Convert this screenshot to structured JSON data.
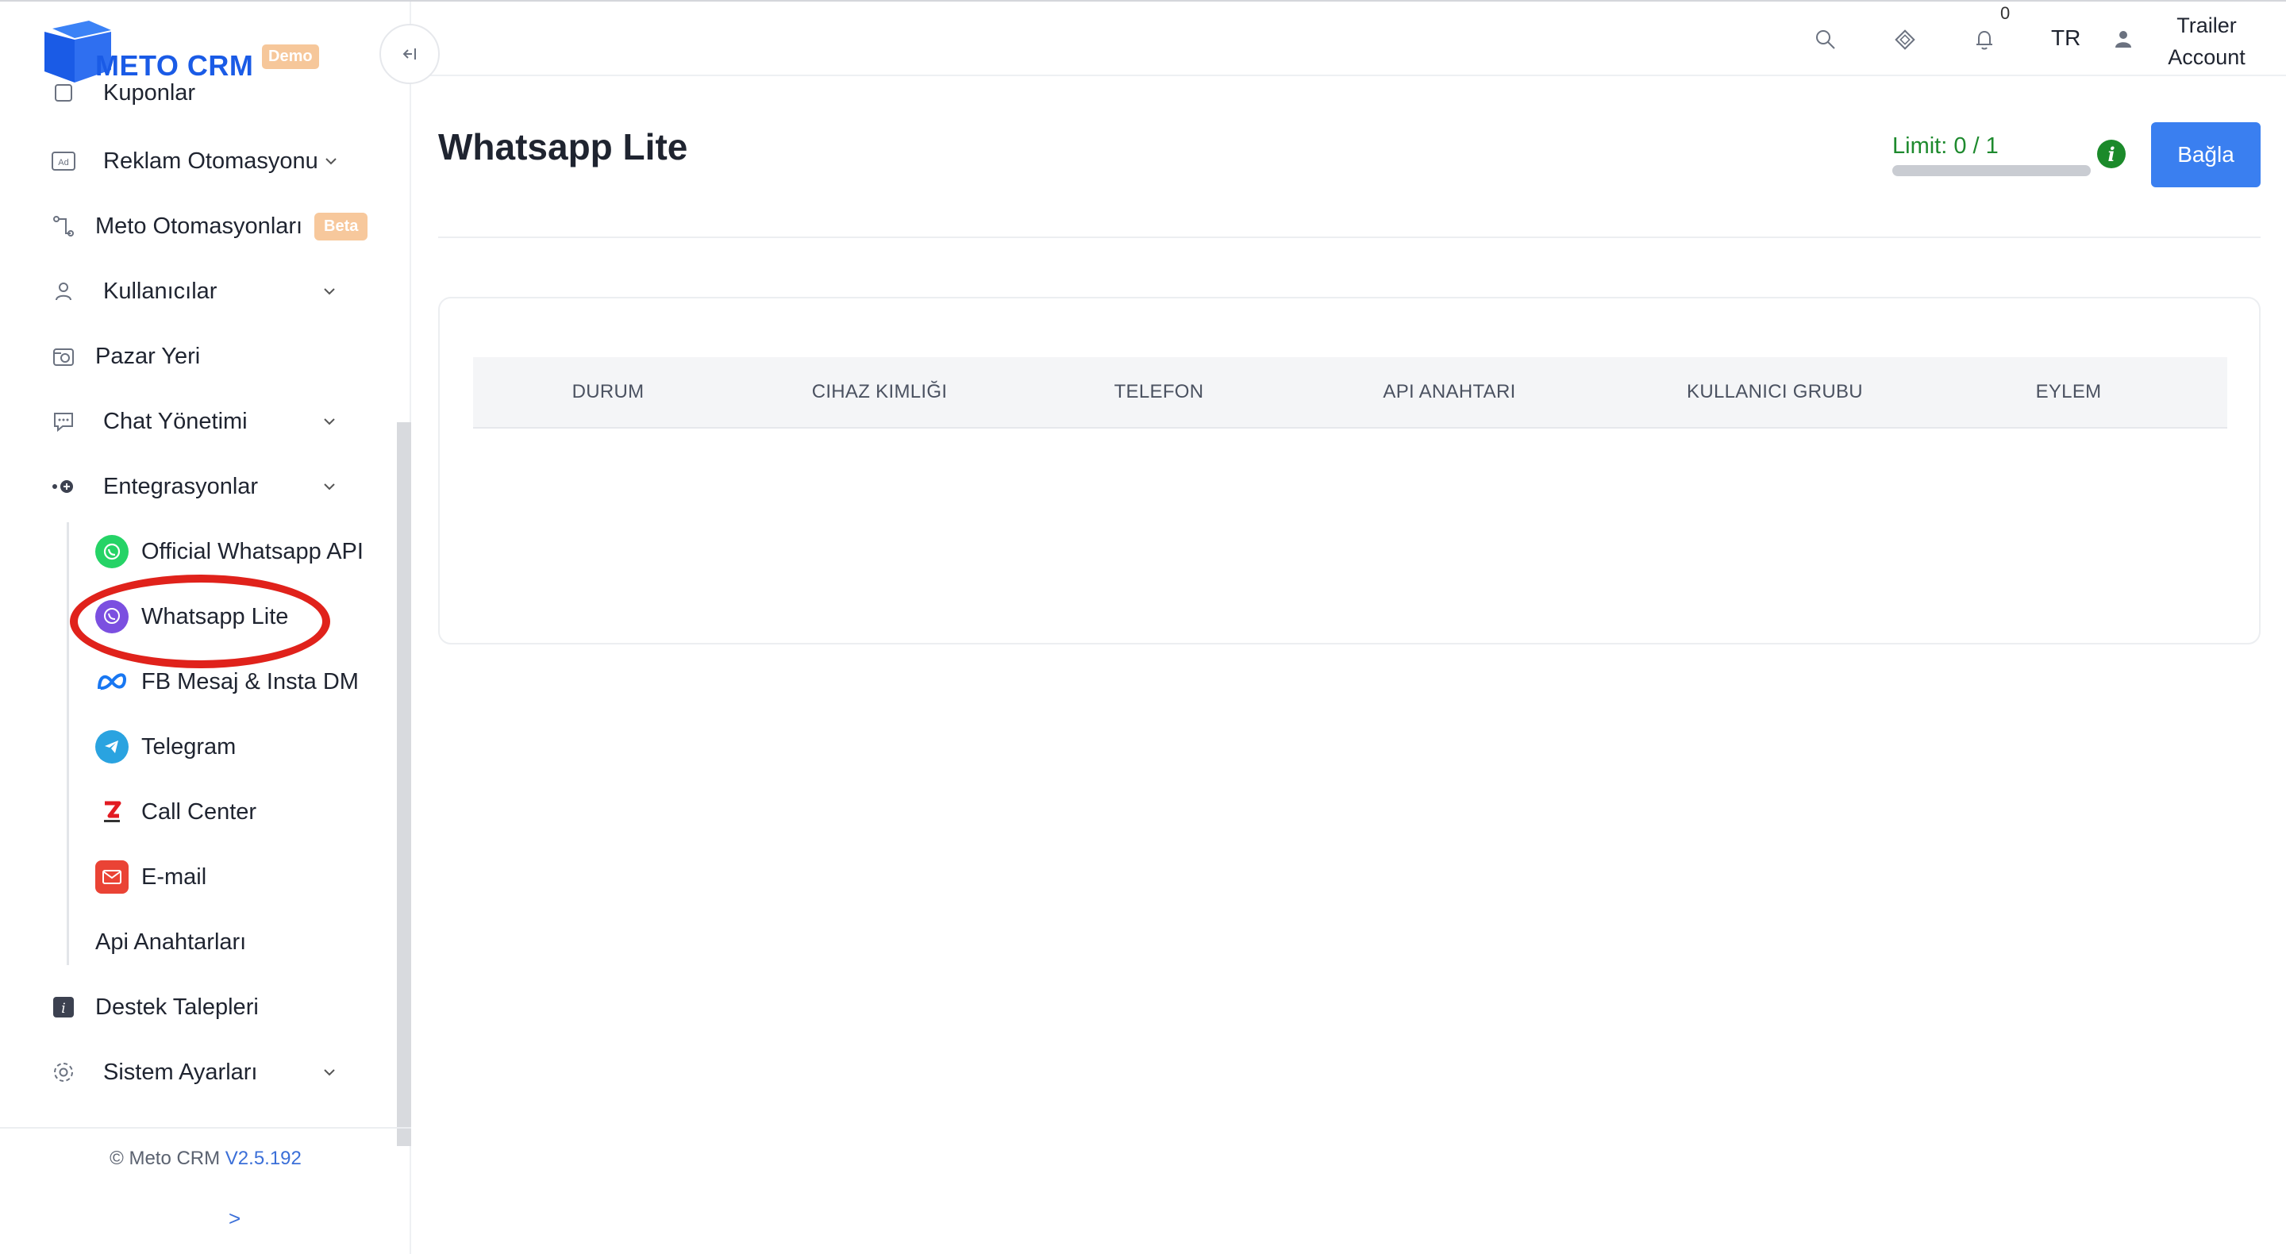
{
  "brand": {
    "name": "METO CRM",
    "badge": "Demo",
    "accent": "#1a5be6"
  },
  "sidebar": {
    "partial_item": "Kuponlar",
    "items": [
      {
        "label": "Reklam Otomasyonu",
        "icon": "ad-icon",
        "expandable": true
      },
      {
        "label": "Meto Otomasyonları",
        "icon": "flow-icon",
        "badge": "Beta"
      },
      {
        "label": "Kullanıcılar",
        "icon": "user-icon",
        "expandable": true
      },
      {
        "label": "Pazar Yeri",
        "icon": "marketplace-icon"
      },
      {
        "label": "Chat Yönetimi",
        "icon": "chat-icon",
        "expandable": true
      },
      {
        "label": "Entegrasyonlar",
        "icon": "integration-icon",
        "expandable": true
      }
    ],
    "sub_items": [
      {
        "label": "Official Whatsapp API",
        "icon": "whatsapp-icon"
      },
      {
        "label": "Whatsapp Lite",
        "icon": "viber-icon",
        "active": true
      },
      {
        "label": "FB Mesaj & Insta DM",
        "icon": "meta-icon"
      },
      {
        "label": "Telegram",
        "icon": "telegram-icon"
      },
      {
        "label": "Call Center",
        "icon": "call-center-icon"
      },
      {
        "label": "E-mail",
        "icon": "email-icon"
      }
    ],
    "api_keys": "Api Anahtarları",
    "bottom_items": [
      {
        "label": "Destek Talepleri",
        "icon": "info-icon"
      },
      {
        "label": "Sistem Ayarları",
        "icon": "gear-icon",
        "expandable": true
      }
    ],
    "footer": {
      "copyright": "© Meto CRM",
      "version": "V2.5.192",
      "arrow": ">"
    }
  },
  "header": {
    "notification_count": "0",
    "language": "TR",
    "user": "Trailer Account"
  },
  "main": {
    "title": "Whatsapp Lite",
    "limit_label": "Limit: 0 / 1",
    "limit_fraction": 0,
    "info": "i",
    "connect_button": "Bağla",
    "table": {
      "columns": [
        "DURUM",
        "CIHAZ KIMLIĞI",
        "TELEFON",
        "API ANAHTARI",
        "KULLANICI GRUBU",
        "EYLEM"
      ],
      "rows": []
    }
  }
}
